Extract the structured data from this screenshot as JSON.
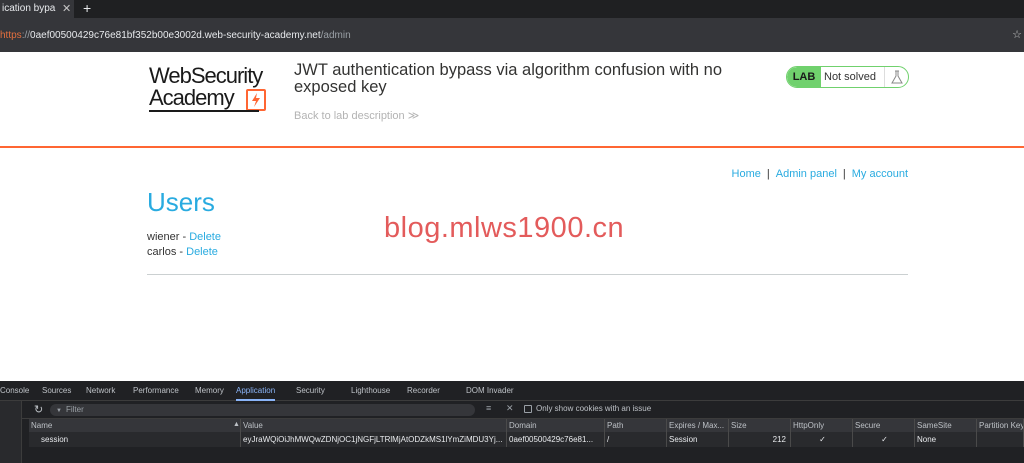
{
  "browser": {
    "tab_title": "ication bypa",
    "tab_close": "✕",
    "new_tab": "+",
    "url_scheme": "https",
    "url_sep": "://",
    "url_host": "0aef00500429c76e81bf352b00e3002d.web-security-academy.net",
    "url_path": "/admin",
    "star_icon": "☆"
  },
  "header": {
    "logo_line1": "WebSecurity",
    "logo_line2": "Academy",
    "lab_title": "JWT authentication bypass via algorithm confusion with no exposed key",
    "back_link": "Back to lab description",
    "back_chevron": "≫",
    "lab_badge": "LAB",
    "lab_status": "Not solved",
    "accent_color": "#ff6633",
    "status_color": "#70d16d"
  },
  "nav": {
    "home": "Home",
    "admin_panel": "Admin panel",
    "my_account": "My account",
    "sep": "|"
  },
  "main": {
    "title": "Users",
    "users": [
      {
        "name": "wiener",
        "dash": " - ",
        "action": "Delete"
      },
      {
        "name": "carlos",
        "dash": " - ",
        "action": "Delete"
      }
    ],
    "link_color": "#29abe0"
  },
  "watermark": "blog.mlws1900.cn",
  "devtools": {
    "tabs": [
      "Console",
      "Sources",
      "Network",
      "Performance",
      "Memory",
      "Application",
      "Security",
      "Lighthouse",
      "Recorder",
      "DOM Invader"
    ],
    "active_tab": "Application",
    "filter_placeholder": "Filter",
    "filter_icon": "▼",
    "refresh_icon": "↻",
    "clear_filter_icon": "≡",
    "close_icon": "✕",
    "only_issue_label": "Only show cookies with an issue",
    "columns": [
      "Name",
      "Value",
      "Domain",
      "Path",
      "Expires / Max...",
      "Size",
      "HttpOnly",
      "Secure",
      "SameSite",
      "Partition Key"
    ],
    "rows": [
      {
        "name": "session",
        "value": "eyJraWQiOiJhMWQwZDNjOC1jNGFjLTRlMjAtODZkMS1lYmZiMDU3Yj...",
        "domain": "0aef00500429c76e81...",
        "path": "/",
        "expires": "Session",
        "size": "212",
        "httponly": "✓",
        "secure": "✓",
        "samesite": "None",
        "partition_key": ""
      }
    ]
  }
}
